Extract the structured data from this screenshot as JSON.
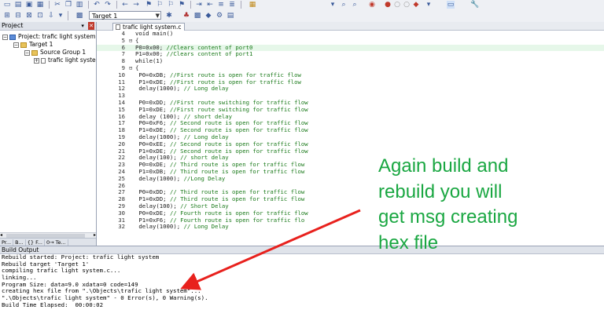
{
  "toolbar": {
    "target_combo": "Target 1"
  },
  "project_panel": {
    "title": "Project",
    "tree": [
      {
        "label": "Project: trafic light system",
        "toggle": "−"
      },
      {
        "label": "Target 1",
        "toggle": "−"
      },
      {
        "label": "Source Group 1",
        "toggle": "−"
      },
      {
        "label": "trafic light syste",
        "toggle": "+"
      }
    ],
    "tabs": [
      "Pr...",
      "B...",
      "{} F...",
      "0→ Te..."
    ]
  },
  "editor": {
    "file_tab": "trafic light system.c",
    "lines": [
      {
        "n": "4",
        "fold": "",
        "code": "void main()",
        "cm": ""
      },
      {
        "n": "5",
        "fold": "⊟",
        "code": "{",
        "cm": ""
      },
      {
        "n": "6",
        "fold": "",
        "code": "P0=0x00; ",
        "cm": "//Clears content of port0",
        "hl": true
      },
      {
        "n": "7",
        "fold": "",
        "code": "P1=0x00; ",
        "cm": "//Clears content of port1"
      },
      {
        "n": "8",
        "fold": "",
        "code": "while(1)",
        "cm": ""
      },
      {
        "n": "9",
        "fold": "⊟",
        "code": "{",
        "cm": ""
      },
      {
        "n": "10",
        "fold": "",
        "code": " P0=0xDB; ",
        "cm": "//First route is open for traffic flow"
      },
      {
        "n": "11",
        "fold": "",
        "code": " P1=0xDE; ",
        "cm": "//First route is open for traffic flow"
      },
      {
        "n": "12",
        "fold": "",
        "code": " delay(1000); ",
        "cm": "// Long delay"
      },
      {
        "n": "13",
        "fold": "",
        "code": "",
        "cm": ""
      },
      {
        "n": "14",
        "fold": "",
        "code": " P0=0xDD; ",
        "cm": "//First route switching for traffic flow"
      },
      {
        "n": "15",
        "fold": "",
        "code": " P1=0xDE; ",
        "cm": "//First route switching for traffic flow"
      },
      {
        "n": "16",
        "fold": "",
        "code": " delay (100); ",
        "cm": "// short delay"
      },
      {
        "n": "17",
        "fold": "",
        "code": " P0=0xF6; ",
        "cm": "// Second route is open for traffic flow"
      },
      {
        "n": "18",
        "fold": "",
        "code": " P1=0xDE; ",
        "cm": "// Second route is open for traffic flow"
      },
      {
        "n": "19",
        "fold": "",
        "code": " delay(1000); ",
        "cm": "// Long delay"
      },
      {
        "n": "20",
        "fold": "",
        "code": " P0=0xEE; ",
        "cm": "// Second route is open for traffic flow"
      },
      {
        "n": "21",
        "fold": "",
        "code": " P1=0xDE; ",
        "cm": "// Second route is open for traffic flow"
      },
      {
        "n": "22",
        "fold": "",
        "code": " delay(100); ",
        "cm": "// short delay"
      },
      {
        "n": "23",
        "fold": "",
        "code": " P0=0xDE; ",
        "cm": "// Third route is open for traffic flow"
      },
      {
        "n": "24",
        "fold": "",
        "code": " P1=0xDB; ",
        "cm": "// Third route is open for traffic flow"
      },
      {
        "n": "25",
        "fold": "",
        "code": " delay(1000); ",
        "cm": "//Long Delay"
      },
      {
        "n": "26",
        "fold": "",
        "code": "",
        "cm": ""
      },
      {
        "n": "27",
        "fold": "",
        "code": " P0=0xDD; ",
        "cm": "// Third route is open for traffic flow"
      },
      {
        "n": "28",
        "fold": "",
        "code": " P1=0xDD; ",
        "cm": "// Third route is open for traffic flow"
      },
      {
        "n": "29",
        "fold": "",
        "code": " delay(100); ",
        "cm": "// Short Delay"
      },
      {
        "n": "30",
        "fold": "",
        "code": " P0=0xDE; ",
        "cm": "// Fourth route is open for traffic flow"
      },
      {
        "n": "31",
        "fold": "",
        "code": " P1=0xF6; ",
        "cm": "// Fourth route is open for traffic flo"
      },
      {
        "n": "32",
        "fold": "",
        "code": " delay(1000); ",
        "cm": "// Long Delay"
      }
    ]
  },
  "build_output": {
    "title": "Build Output",
    "lines": [
      "Rebuild started: Project: trafic light system",
      "Rebuild target 'Target 1'",
      "compiling trafic light system.c...",
      "linking...",
      "Program Size: data=9.0 xdata=0 code=149",
      "creating hex file from \".\\Objects\\trafic light system\"...",
      "\".\\Objects\\trafic light system\" - 0 Error(s), 0 Warning(s).",
      "Build Time Elapsed:  00:00:02"
    ]
  },
  "annotation": {
    "lines": [
      "Again build and",
      "rebuild you will",
      "get msg creating",
      "hex file"
    ],
    "color": "#1aa742",
    "arrow_color": "#e8211d"
  }
}
